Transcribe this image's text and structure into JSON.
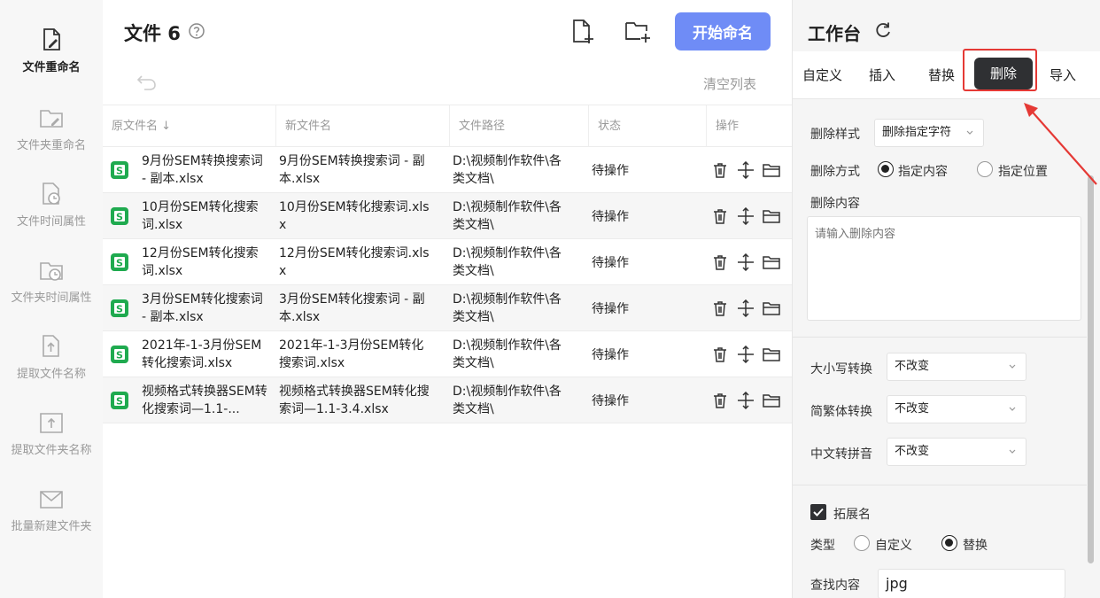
{
  "sidebar": {
    "items": [
      {
        "label": "文件重命名",
        "icon": "file-edit-icon"
      },
      {
        "label": "文件夹重命名",
        "icon": "folder-edit-icon"
      },
      {
        "label": "文件时间属性",
        "icon": "file-clock-icon"
      },
      {
        "label": "文件夹时间属性",
        "icon": "folder-clock-icon"
      },
      {
        "label": "提取文件名称",
        "icon": "file-export-icon"
      },
      {
        "label": "提取文件夹名称",
        "icon": "folder-export-icon"
      },
      {
        "label": "批量新建文件夹",
        "icon": "folder-mail-icon"
      }
    ]
  },
  "header": {
    "title": "文件 6",
    "start_button": "开始命名",
    "clear_list": "清空列表"
  },
  "table": {
    "columns": [
      "原文件名 ↓",
      "新文件名",
      "文件路径",
      "状态",
      "操作"
    ],
    "rows": [
      {
        "orig": "9月份SEM转换搜索词 - 副本.xlsx",
        "new": "9月份SEM转换搜索词 - 副本.xlsx",
        "path": "D:\\视频制作软件\\各类文档\\",
        "status": "待操作"
      },
      {
        "orig": "10月份SEM转化搜索词.xlsx",
        "new": "10月份SEM转化搜索词.xlsx",
        "path": "D:\\视频制作软件\\各类文档\\",
        "status": "待操作"
      },
      {
        "orig": "12月份SEM转化搜索词.xlsx",
        "new": "12月份SEM转化搜索词.xlsx",
        "path": "D:\\视频制作软件\\各类文档\\",
        "status": "待操作"
      },
      {
        "orig": "3月份SEM转化搜索词 - 副本.xlsx",
        "new": "3月份SEM转化搜索词 - 副本.xlsx",
        "path": "D:\\视频制作软件\\各类文档\\",
        "status": "待操作"
      },
      {
        "orig": "2021年-1-3月份SEM转化搜索词.xlsx",
        "new": "2021年-1-3月份SEM转化搜索词.xlsx",
        "path": "D:\\视频制作软件\\各类文档\\",
        "status": "待操作"
      },
      {
        "orig": "视频格式转换器SEM转化搜索词—1.1-...",
        "new": "视频格式转换器SEM转化搜索词—1.1-3.4.xlsx",
        "path": "D:\\视频制作软件\\各类文档\\",
        "status": "待操作"
      }
    ]
  },
  "workbench": {
    "title": "工作台",
    "tabs": [
      "自定义",
      "插入",
      "替换",
      "删除",
      "导入"
    ],
    "active_tab": "删除",
    "delete_style_label": "删除样式",
    "delete_style_value": "删除指定字符",
    "delete_mode_label": "删除方式",
    "mode_options": [
      "指定内容",
      "指定位置"
    ],
    "delete_content_label": "删除内容",
    "delete_content_placeholder": "请输入删除内容",
    "case_label": "大小写转换",
    "case_value": "不改变",
    "trad_label": "简繁体转换",
    "trad_value": "不改变",
    "pinyin_label": "中文转拼音",
    "pinyin_value": "不改变",
    "ext_label": "拓展名",
    "type_label": "类型",
    "type_options": [
      "自定义",
      "替换"
    ],
    "find_label": "查找内容",
    "find_value": "jpg"
  },
  "colors": {
    "accent": "#6f8cf6",
    "active_tab": "#2f3033",
    "highlight": "#e53935",
    "excel_green": "#1faa4f"
  }
}
